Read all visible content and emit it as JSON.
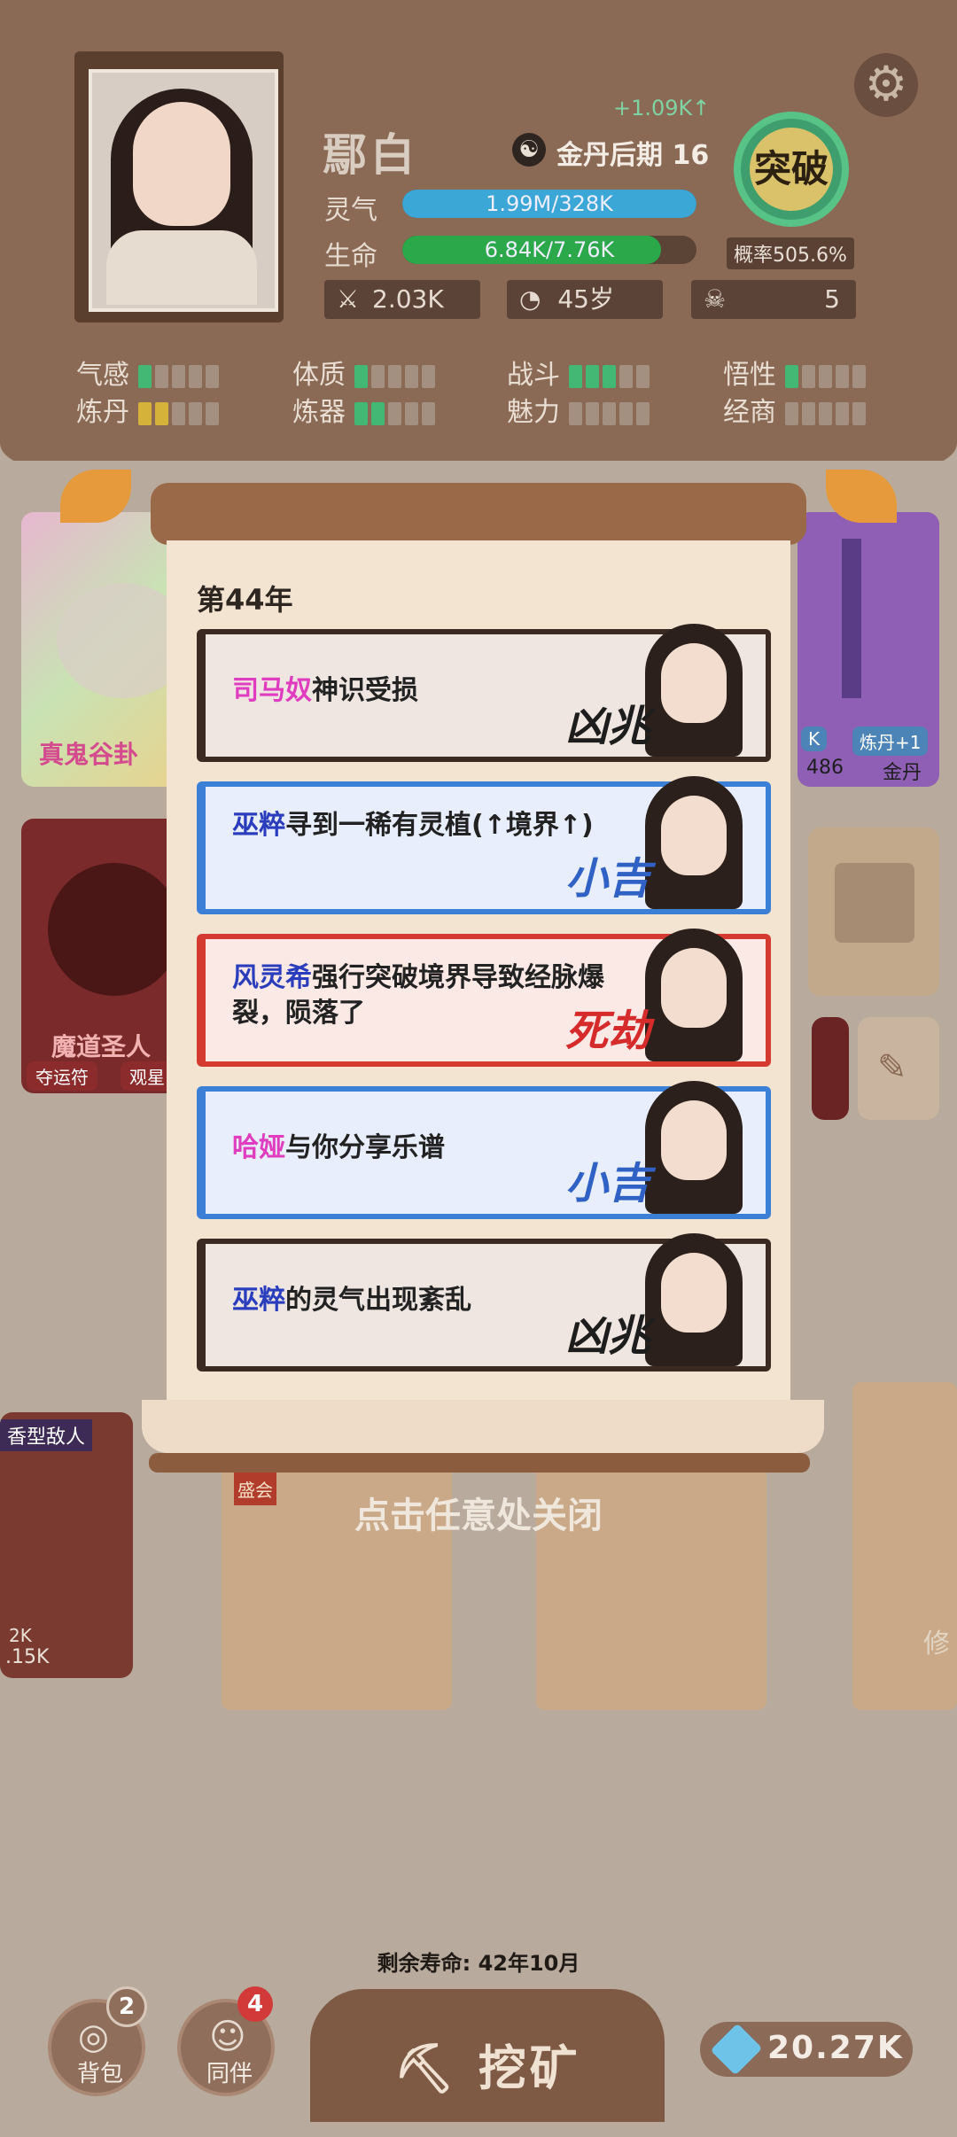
{
  "player": {
    "name": "鄢白",
    "realm": "金丹后期 16",
    "qi_rate": "+1.09K↑",
    "lingqi_label": "灵气",
    "lingqi_value": "1.99M/328K",
    "lingqi_fill": 1.0,
    "life_label": "生命",
    "life_value": "6.84K/7.76K",
    "life_fill": 0.88,
    "attack": "2.03K",
    "age": "45岁",
    "kills": "5"
  },
  "breakthrough": {
    "label": "突破",
    "prob": "概率505.6%"
  },
  "attributes": [
    {
      "label": "气感",
      "level": 1,
      "max": 5,
      "color": "green"
    },
    {
      "label": "体质",
      "level": 1,
      "max": 5,
      "color": "green"
    },
    {
      "label": "战斗",
      "level": 3,
      "max": 5,
      "color": "green"
    },
    {
      "label": "悟性",
      "level": 1,
      "max": 5,
      "color": "green"
    },
    {
      "label": "炼丹",
      "level": 2,
      "max": 5,
      "color": "gold"
    },
    {
      "label": "炼器",
      "level": 2,
      "max": 5,
      "color": "green"
    },
    {
      "label": "魅力",
      "level": 0,
      "max": 5,
      "color": "green"
    },
    {
      "label": "经商",
      "level": 0,
      "max": 5,
      "color": "green"
    }
  ],
  "bg_cards": {
    "left_top": "真鬼谷卦",
    "left_mid": "魔道圣人",
    "left_mid_tags": [
      "夺运符",
      "观星"
    ],
    "right_top_tags": [
      "K",
      "炼丹+1"
    ],
    "right_top_vals": [
      "486",
      "金丹"
    ],
    "enemy_label": "香型敌人",
    "enemy_val1": "2K",
    "enemy_val2": ".15K",
    "stamp": "盛会",
    "right_bottom": "修"
  },
  "modal": {
    "year": "第44年",
    "events": [
      {
        "name": "司马奴",
        "name_color": "pink",
        "text": "神识受损",
        "tag": "凶兆",
        "tag_color": "#1d1d1d",
        "border": "#3a2a22",
        "bg": "#efe6e2"
      },
      {
        "name": "巫粹",
        "name_color": "blue",
        "text": "寻到一稀有灵植(↑境界↑)",
        "tag": "小吉",
        "tag_color": "#2f62c4",
        "border": "#3b7fd6",
        "bg": "#e8eefb"
      },
      {
        "name": "风灵希",
        "name_color": "blue",
        "text": "强行突破境界导致经脉爆裂，陨落了",
        "tag": "死劫",
        "tag_color": "#d62b2b",
        "border": "#d43a30",
        "bg": "#fbe9e6"
      },
      {
        "name": "哈娅",
        "name_color": "pink",
        "text": "与你分享乐谱",
        "tag": "小吉",
        "tag_color": "#2f62c4",
        "border": "#3b7fd6",
        "bg": "#e8eefb"
      },
      {
        "name": "巫粹",
        "name_color": "blue",
        "text": "的灵气出现紊乱",
        "tag": "凶兆",
        "tag_color": "#1d1d1d",
        "border": "#3a2a22",
        "bg": "#efe6e2"
      }
    ],
    "close_hint": "点击任意处关闭"
  },
  "lifespan": "剩余寿命: 42年10月",
  "footer": {
    "bag_label": "背包",
    "bag_badge": "2",
    "companion_label": "同伴",
    "companion_badge": "4",
    "mine_label": "挖矿",
    "gems": "20.27K"
  }
}
